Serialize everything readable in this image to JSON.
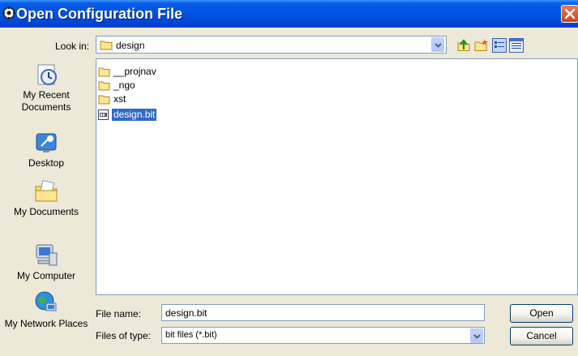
{
  "window": {
    "title": "Open Configuration File",
    "icon": "gear-icon",
    "close_icon": "close-icon",
    "close_color": "#d7552a",
    "titlebar_color": "#0054e3"
  },
  "toolbar": {
    "look_in_label": "Look in:",
    "look_in_value": "design",
    "buttons": [
      "up-folder-icon",
      "new-folder-icon",
      "list-view-icon",
      "details-view-icon"
    ]
  },
  "places": [
    {
      "label": "My Recent Documents",
      "icon": "recent-documents-icon"
    },
    {
      "label": "Desktop",
      "icon": "desktop-icon"
    },
    {
      "label": "My Documents",
      "icon": "my-documents-icon"
    },
    {
      "label": "My Computer",
      "icon": "my-computer-icon"
    },
    {
      "label": "My Network Places",
      "icon": "network-places-icon"
    }
  ],
  "files": [
    {
      "name": "__projnav",
      "type": "folder",
      "selected": false
    },
    {
      "name": "_ngo",
      "type": "folder",
      "selected": false
    },
    {
      "name": "xst",
      "type": "folder",
      "selected": false
    },
    {
      "name": "design.bit",
      "type": "file",
      "selected": true
    }
  ],
  "file_name": {
    "label": "File name:",
    "value": "design.bit"
  },
  "file_type": {
    "label": "Files of type:",
    "value": "bit files (*.bit)"
  },
  "buttons": {
    "open": "Open",
    "cancel": "Cancel"
  },
  "colors": {
    "selection": "#316ac5",
    "dialog_bg": "#ece9d8"
  }
}
